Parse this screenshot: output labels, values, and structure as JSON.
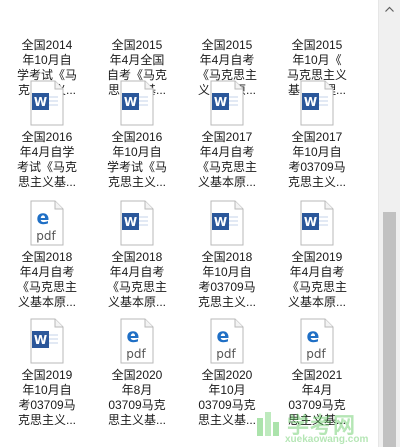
{
  "files": [
    {
      "label": "全国2014\n年10月自\n学考试《马\n克思主义...",
      "type": "word"
    },
    {
      "label": "全国2015\n年4月全国\n自考《马克\n思主义基...",
      "type": "word"
    },
    {
      "label": "全国2015\n年4月自考\n《马克思主\n义基本原...",
      "type": "word"
    },
    {
      "label": "全国2015\n年10月《\n马克思主义\n基本原理...",
      "type": "word"
    },
    {
      "label": "全国2016\n年4月自学\n考试《马克\n思主义基...",
      "type": "word"
    },
    {
      "label": "全国2016\n年10月自\n学考试《马\n克思主义...",
      "type": "word"
    },
    {
      "label": "全国2017\n年4月自考\n《马克思主\n义基本原...",
      "type": "word"
    },
    {
      "label": "全国2017\n年10月自\n考03709马\n克思主义...",
      "type": "word"
    },
    {
      "label": "全国2018\n年4月自考\n《马克思主\n义基本原...",
      "type": "pdf"
    },
    {
      "label": "全国2018\n年4月自考\n《马克思主\n义基本原...",
      "type": "word"
    },
    {
      "label": "全国2018\n年10月自\n考03709马\n克思主义...",
      "type": "word"
    },
    {
      "label": "全国2019\n年4月自考\n《马克思主\n义基本原...",
      "type": "word"
    },
    {
      "label": "全国2019\n年10月自\n考03709马\n克思主义...",
      "type": "word"
    },
    {
      "label": "全国2020\n年8月\n03709马克\n思主义基...",
      "type": "pdf"
    },
    {
      "label": "全国2020\n年10月\n03709马克\n思主义基...",
      "type": "pdf"
    },
    {
      "label": "全国2021\n年4月\n03709马克\n思主义基...",
      "type": "pdf"
    }
  ],
  "icons": {
    "word_color": "#2b579a",
    "pdf_color": "#1f6fc5",
    "word_letter": "W",
    "pdf_text": "pdf",
    "pdf_glyph": "e"
  },
  "watermark": {
    "text": "学考网",
    "sub": "xuekaowang.com"
  }
}
